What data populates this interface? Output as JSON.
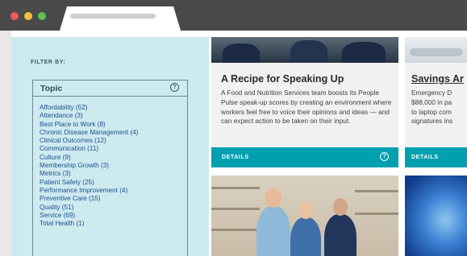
{
  "filter": {
    "label": "FILTER BY:",
    "section_title": "Topic",
    "info_glyph": "?",
    "topics": [
      "Affordability (52)",
      "Attendance (3)",
      "Best Place to Work (8)",
      "Chronic Disease Management (4)",
      "Clinical Outcomes (12)",
      "Communication (11)",
      "Culture (9)",
      "Membership Growth (3)",
      "Metrics (3)",
      "Patient Safety (25)",
      "Performance Improvement (4)",
      "Preventive Care (15)",
      "Quality (51)",
      "Service (69)",
      "Total Health (1)"
    ]
  },
  "cards": [
    {
      "title": "A Recipe for Speaking Up",
      "text": "A Food and Nutrition Services team boosts its People Pulse speak-up scores by creating an environment where workers feel free to voice their opinions and ideas — and can expect action to be taken on their input.",
      "details_label": "DETAILS",
      "details_icon": "?"
    },
    {
      "title": "Savings Ar",
      "text_lines": [
        "Emergency D",
        "$88,000 in pa",
        "to laptop com",
        "signatures ins"
      ],
      "details_label": "DETAILS"
    }
  ],
  "colors": {
    "filter_bg": "#cdeaef",
    "accent": "#00a0b0",
    "link": "#1e4f8f"
  }
}
